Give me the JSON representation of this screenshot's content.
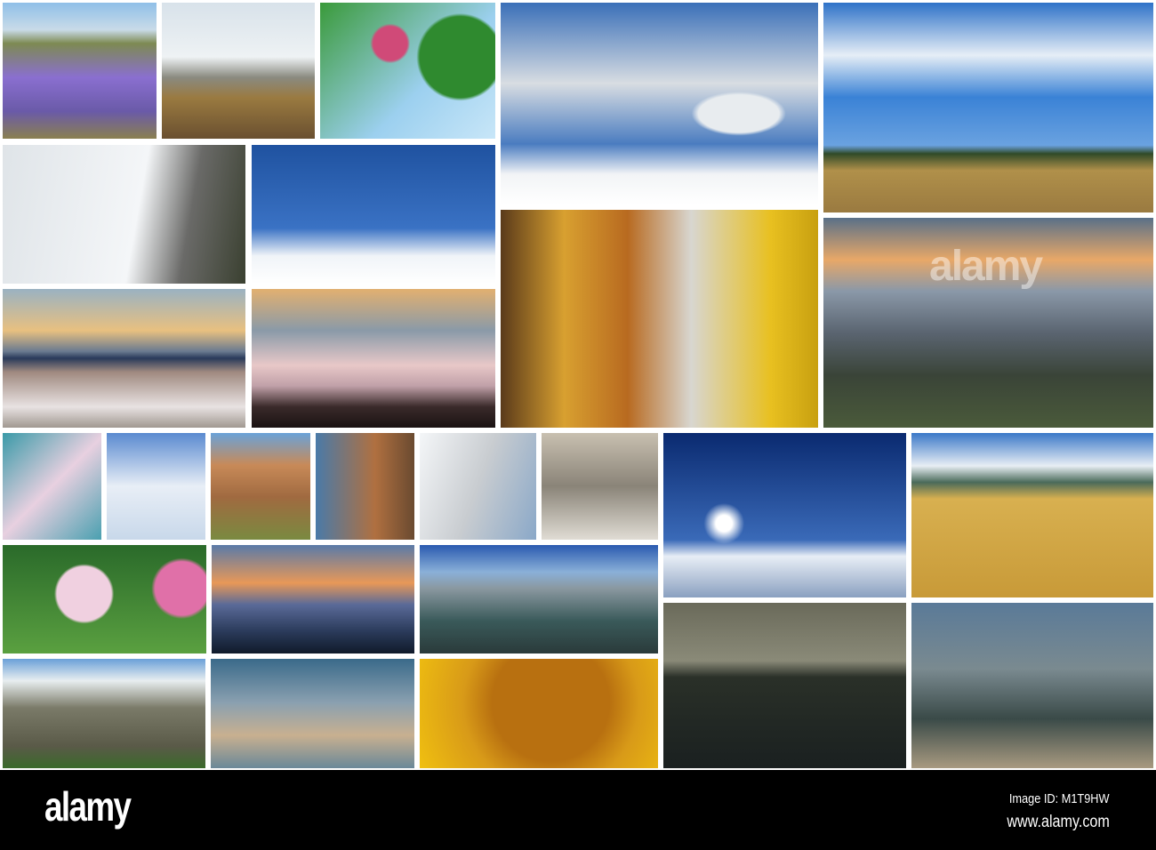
{
  "watermark": {
    "logo_text": "alamy"
  },
  "footer": {
    "logo": "alamy",
    "image_id": "Image ID: M1T9HW",
    "url": "www.alamy.com"
  }
}
